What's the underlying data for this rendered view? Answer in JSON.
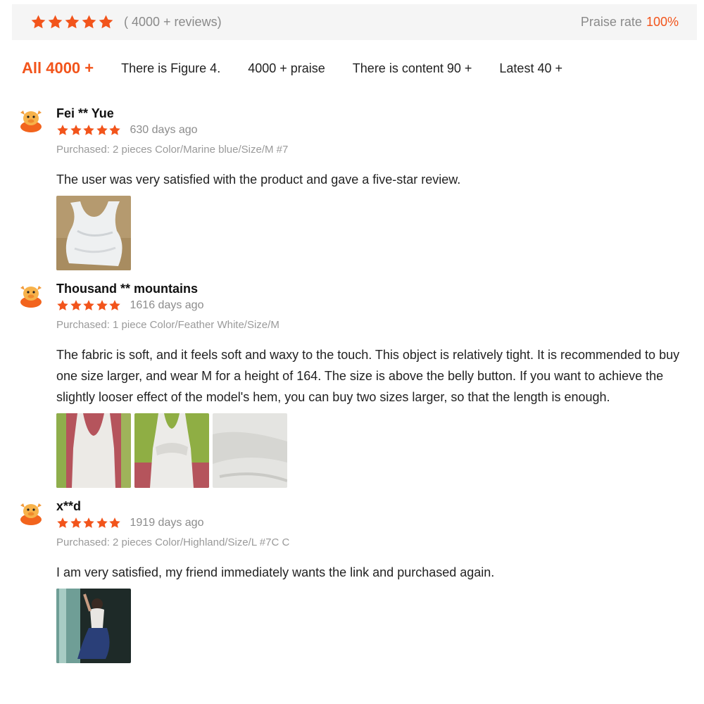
{
  "summary": {
    "rating_stars": 5,
    "reviews_count": "( 4000 + reviews)",
    "praise_label": "Praise rate",
    "praise_value": "100%"
  },
  "tabs": [
    {
      "label": "All 4000 +",
      "active": true
    },
    {
      "label": "There is Figure 4.",
      "active": false
    },
    {
      "label": "4000 + praise",
      "active": false
    },
    {
      "label": "There is content 90 +",
      "active": false
    },
    {
      "label": "Latest 40 +",
      "active": false
    }
  ],
  "reviews": [
    {
      "user": "Fei ** Yue",
      "stars": 5,
      "days": "630 days ago",
      "purchased": "Purchased: 2 pieces Color/Marine blue/Size/M #7",
      "content": "The user was very satisfied with the product and gave a five-star review.",
      "photos": [
        "white-tank-crumpled-photo"
      ]
    },
    {
      "user": "Thousand ** mountains",
      "stars": 5,
      "days": "1616 days ago",
      "purchased": "Purchased: 1 piece Color/Feather White/Size/M",
      "content": "The fabric is soft, and it feels soft and waxy to the touch. This object is relatively tight. It is recommended to buy one size larger, and wear M for a height of 164. The size is above the belly button. If you want to achieve the slightly looser effect of the model's hem, you can buy two sizes larger, so that the length is enough.",
      "photos": [
        "white-tank-front-photo",
        "white-tank-back-photo",
        "fabric-closeup-photo"
      ]
    },
    {
      "user": "x**d",
      "stars": 5,
      "days": "1919 days ago",
      "purchased": "Purchased: 2 pieces Color/Highland/Size/L #7C C",
      "content": "I am very satisfied, my friend immediately wants the link and purchased again.",
      "photos": [
        "mirror-selfie-photo"
      ]
    }
  ],
  "colors": {
    "accent": "#f2541b",
    "muted": "#8c8c8c",
    "summary_bg": "#f5f5f5"
  }
}
